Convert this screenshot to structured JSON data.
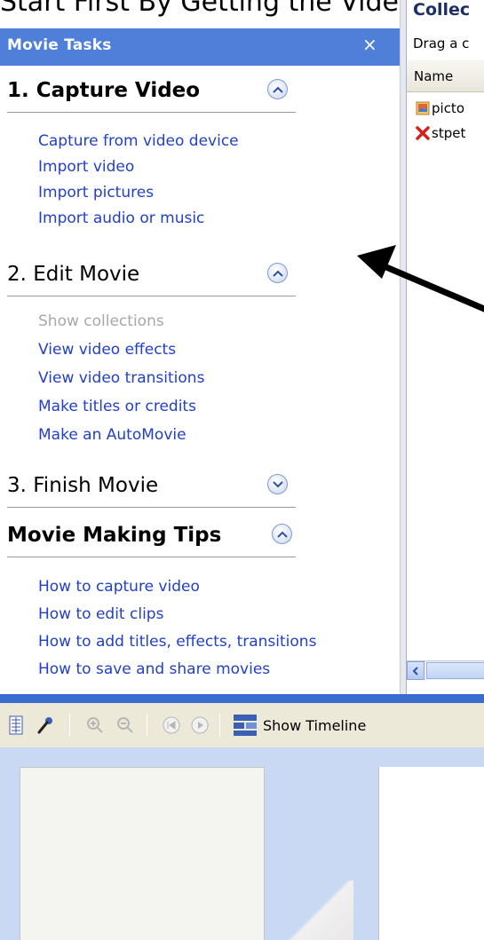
{
  "caption": "Start First By Getting the Video",
  "task_pane": {
    "title": "Movie Tasks",
    "close_glyph": "×",
    "sections": [
      {
        "label": "1. Capture Video",
        "state": "expanded",
        "links": [
          {
            "text": "Capture from video device",
            "enabled": true
          },
          {
            "text": "Import video",
            "enabled": true
          },
          {
            "text": "Import pictures",
            "enabled": true
          },
          {
            "text": "Import audio or music",
            "enabled": true
          }
        ]
      },
      {
        "label": "2. Edit Movie",
        "state": "expanded",
        "links": [
          {
            "text": "Show collections",
            "enabled": false
          },
          {
            "text": "View video effects",
            "enabled": true
          },
          {
            "text": "View video transitions",
            "enabled": true
          },
          {
            "text": "Make titles or credits",
            "enabled": true
          },
          {
            "text": "Make an AutoMovie",
            "enabled": true
          }
        ]
      },
      {
        "label": "3. Finish Movie",
        "state": "collapsed",
        "links": []
      },
      {
        "label": "Movie Making Tips",
        "state": "expanded",
        "links": [
          {
            "text": "How to capture video",
            "enabled": true
          },
          {
            "text": "How to edit clips",
            "enabled": true
          },
          {
            "text": "How to add titles, effects, transitions",
            "enabled": true
          },
          {
            "text": "How to save and share movies",
            "enabled": true
          }
        ]
      }
    ]
  },
  "collections_pane": {
    "title": "Collec",
    "hint": "Drag a c",
    "column_name": "Name",
    "items": [
      {
        "text": "picto",
        "icon": "image-file-icon"
      },
      {
        "text": "stpet",
        "icon": "missing-file-icon"
      }
    ]
  },
  "toolbar": {
    "show_timeline_label": "Show Timeline",
    "buttons": [
      "storyboard-icon",
      "properties-icon",
      "zoom-in-icon",
      "zoom-out-icon",
      "rewind-icon",
      "play-icon"
    ]
  },
  "colors": {
    "header_blue": "#4f7fd9",
    "link_blue": "#2240c8",
    "disabled_gray": "#a8a8a8",
    "storyboard_bg": "#c9d9f4"
  }
}
